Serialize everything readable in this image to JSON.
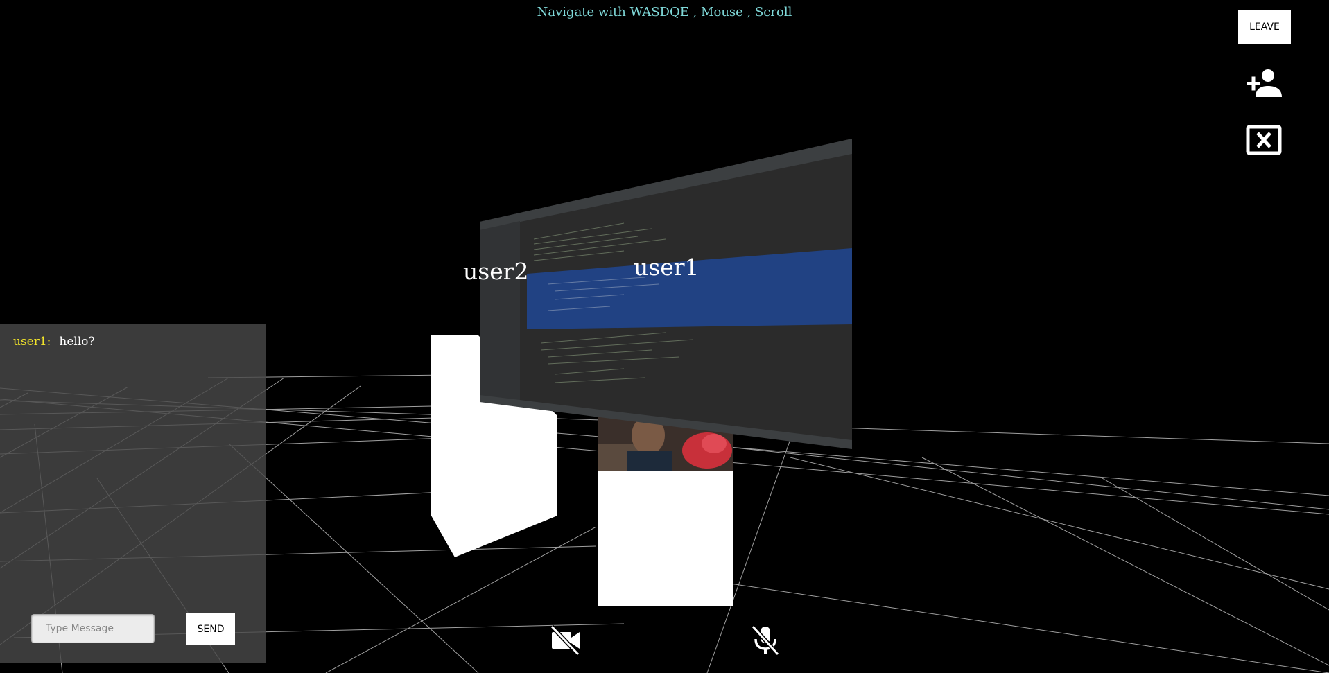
{
  "header": {
    "hint": "Navigate with WASDQE , Mouse , Scroll"
  },
  "controls": {
    "leave_label": "LEAVE",
    "add_user_icon": "person-add-icon",
    "close_share_icon": "close-box-icon"
  },
  "scene": {
    "users": [
      {
        "name": "user2"
      },
      {
        "name": "user1"
      }
    ],
    "shared_screen": "code-editor-screen-share",
    "colors": {
      "background": "#000000",
      "grid": "#bbbbbb",
      "selection": "#214283",
      "editor": "#2b2b2b"
    }
  },
  "chat": {
    "messages": [
      {
        "user": "user1:",
        "text": "hello?"
      }
    ],
    "input_placeholder": "Type Message",
    "send_label": "SEND"
  },
  "media": {
    "camera_icon": "videocam-off-icon",
    "mic_icon": "mic-off-icon"
  }
}
